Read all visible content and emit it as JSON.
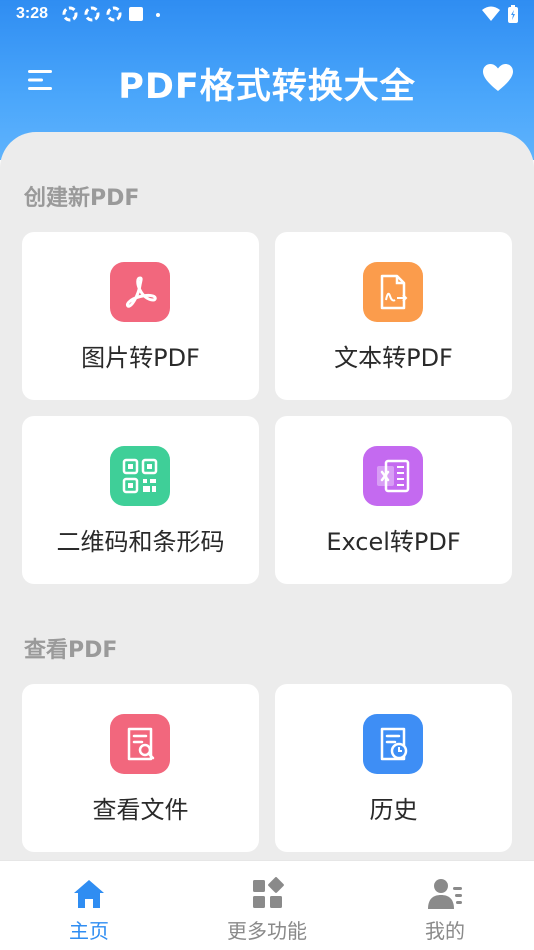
{
  "status_bar": {
    "time": "3:28"
  },
  "app": {
    "title": "PDF格式转换大全"
  },
  "sections": {
    "create": {
      "title": "创建新PDF",
      "cards": [
        {
          "label": "图片转PDF",
          "icon": "pdf-acrobat-icon",
          "color": "#f2677d"
        },
        {
          "label": "文本转PDF",
          "icon": "text-document-icon",
          "color": "#fb9c4c"
        },
        {
          "label": "二维码和条形码",
          "icon": "qr-code-icon",
          "color": "#3fcf98"
        },
        {
          "label": "Excel转PDF",
          "icon": "excel-icon",
          "color": "#c46af0"
        }
      ]
    },
    "view": {
      "title": "查看PDF",
      "cards": [
        {
          "label": "查看文件",
          "icon": "view-file-icon",
          "color": "#f2677d"
        },
        {
          "label": "历史",
          "icon": "history-icon",
          "color": "#3e8ef5"
        }
      ]
    }
  },
  "tabs": [
    {
      "label": "主页",
      "icon": "home-icon",
      "active": true
    },
    {
      "label": "更多功能",
      "icon": "grid-icon",
      "active": false
    },
    {
      "label": "我的",
      "icon": "profile-icon",
      "active": false
    }
  ],
  "colors": {
    "accent": "#2f8df2",
    "tab_inactive": "#8a8a8a",
    "background": "#ececec"
  }
}
